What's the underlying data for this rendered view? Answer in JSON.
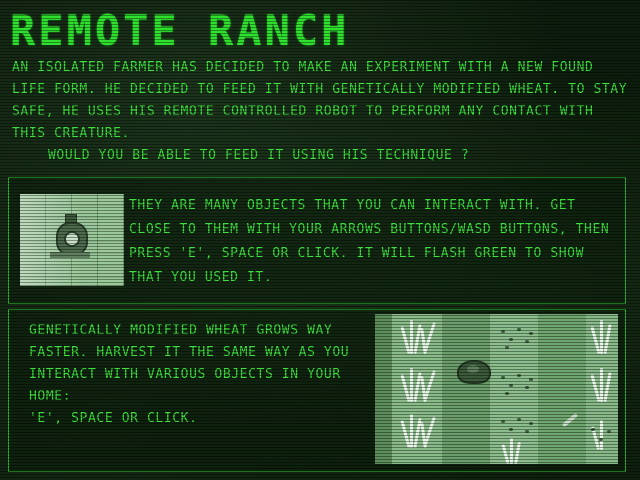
{
  "title": "REMOTE RANCH",
  "intro": {
    "paragraph": "AN ISOLATED FARMER HAS DECIDED TO MAKE AN EXPERIMENT WITH A NEW FOUND LIFE FORM. HE DECIDED TO FEED IT WITH GENETICALLY MODIFIED WHEAT. TO STAY SAFE, HE USES HIS REMOTE CONTROLLED ROBOT TO PERFORM ANY CONTACT WITH THIS CREATURE.",
    "question": "WOULD YOU BE ABLE TO FEED IT USING HIS TECHNIQUE ?"
  },
  "panel_interact": {
    "text": "THEY ARE MANY OBJECTS THAT YOU CAN INTERACT WITH. GET CLOSE TO THEM WITH YOUR ARROWS BUTTONS/WASD BUTTONS, THEN PRESS 'E', SPACE OR CLICK. IT WILL FLASH GREEN TO SHOW THAT YOU USED IT."
  },
  "panel_wheat": {
    "line1": "GENETICALLY MODIFIED WHEAT GROWS WAY FASTER. HARVEST IT THE SAME WAY AS YOU INTERACT WITH VARIOUS OBJECTS IN YOUR HOME:",
    "line2": "'E', SPACE OR CLICK."
  },
  "colors": {
    "text": "#3ee03e",
    "border": "#2fb72f",
    "background": "#0d1d0d"
  },
  "icons": [
    "wall-device-icon",
    "wheat-field-icon",
    "creature-icon",
    "bone-icon"
  ]
}
